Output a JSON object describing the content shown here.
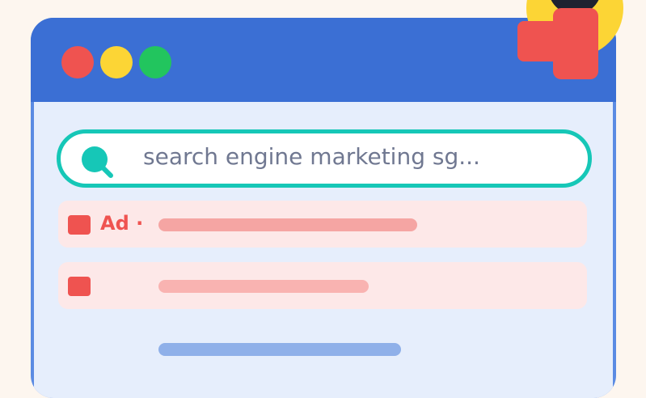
{
  "search": {
    "query": "search engine marketing sg...",
    "icon": "search-icon"
  },
  "results": [
    {
      "label": "Ad ·",
      "type": "ad"
    },
    {
      "label": "",
      "type": "ad"
    }
  ],
  "colors": {
    "titlebar": "#3b6fd4",
    "accent": "#16c7b7",
    "ad": "#ef5350"
  }
}
